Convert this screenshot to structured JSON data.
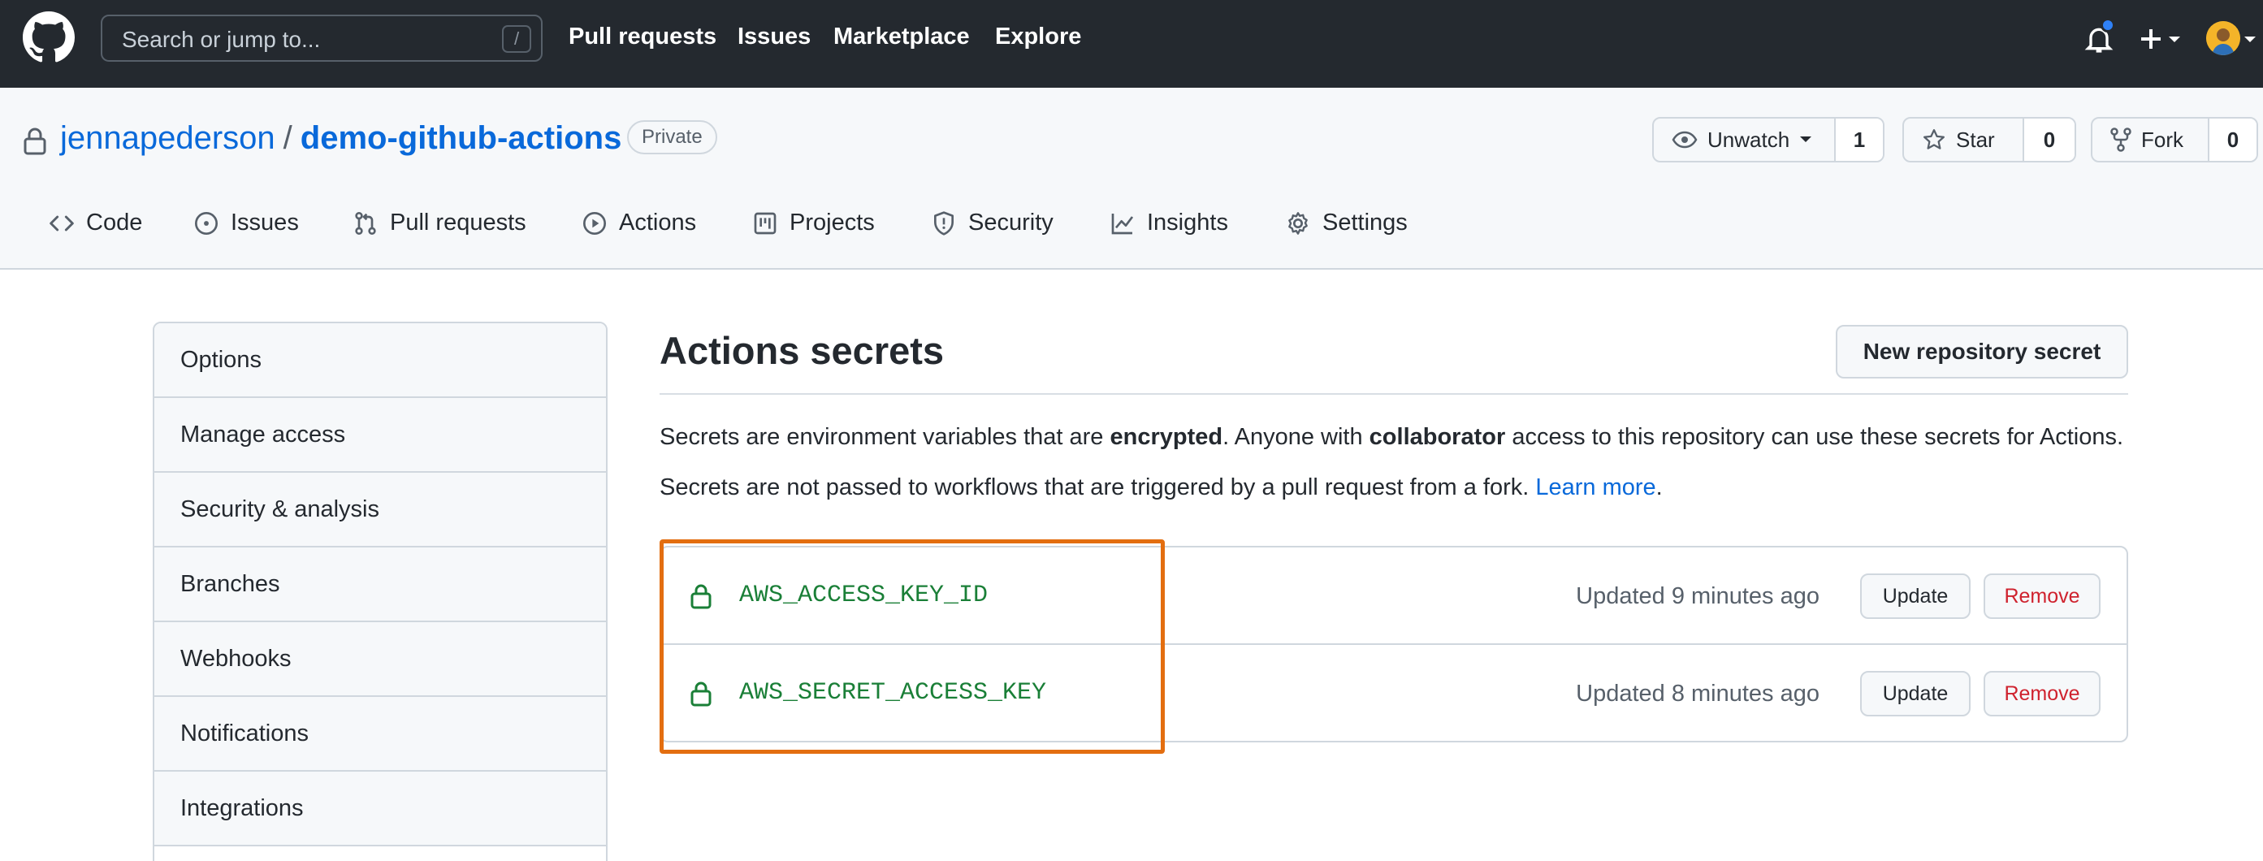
{
  "header": {
    "search_placeholder": "Search or jump to...",
    "search_shortcut": "/",
    "nav": [
      "Pull requests",
      "Issues",
      "Marketplace",
      "Explore"
    ]
  },
  "repo": {
    "owner": "jennapederson",
    "separator": "/",
    "name": "demo-github-actions",
    "visibility": "Private",
    "unwatch_label": "Unwatch",
    "watch_count": "1",
    "star_label": "Star",
    "star_count": "0",
    "fork_label": "Fork",
    "fork_count": "0"
  },
  "tabs": [
    {
      "label": "Code",
      "icon": "code-icon"
    },
    {
      "label": "Issues",
      "icon": "issue-opened-icon"
    },
    {
      "label": "Pull requests",
      "icon": "git-pull-request-icon"
    },
    {
      "label": "Actions",
      "icon": "play-icon"
    },
    {
      "label": "Projects",
      "icon": "project-icon"
    },
    {
      "label": "Security",
      "icon": "shield-icon"
    },
    {
      "label": "Insights",
      "icon": "graph-icon"
    },
    {
      "label": "Settings",
      "icon": "gear-icon"
    }
  ],
  "sidebar": {
    "items": [
      "Options",
      "Manage access",
      "Security & analysis",
      "Branches",
      "Webhooks",
      "Notifications",
      "Integrations"
    ]
  },
  "main": {
    "title": "Actions secrets",
    "new_secret_button": "New repository secret",
    "desc1_prefix": "Secrets are environment variables that are ",
    "desc1_bold1": "encrypted",
    "desc1_mid": ". Anyone with ",
    "desc1_bold2": "collaborator",
    "desc1_suffix": " access to this repository can use these secrets for Actions.",
    "desc2_prefix": "Secrets are not passed to workflows that are triggered by a pull request from a fork. ",
    "desc2_link": "Learn more",
    "desc2_suffix": ".",
    "secrets": [
      {
        "name": "AWS_ACCESS_KEY_ID",
        "updated": "Updated 9 minutes ago",
        "update_label": "Update",
        "remove_label": "Remove"
      },
      {
        "name": "AWS_SECRET_ACCESS_KEY",
        "updated": "Updated 8 minutes ago",
        "update_label": "Update",
        "remove_label": "Remove"
      }
    ]
  },
  "colors": {
    "header_bg": "#24292f",
    "link": "#0969da",
    "secret_name": "#1a7f37",
    "danger": "#cf222e",
    "highlight": "#e36e10"
  }
}
